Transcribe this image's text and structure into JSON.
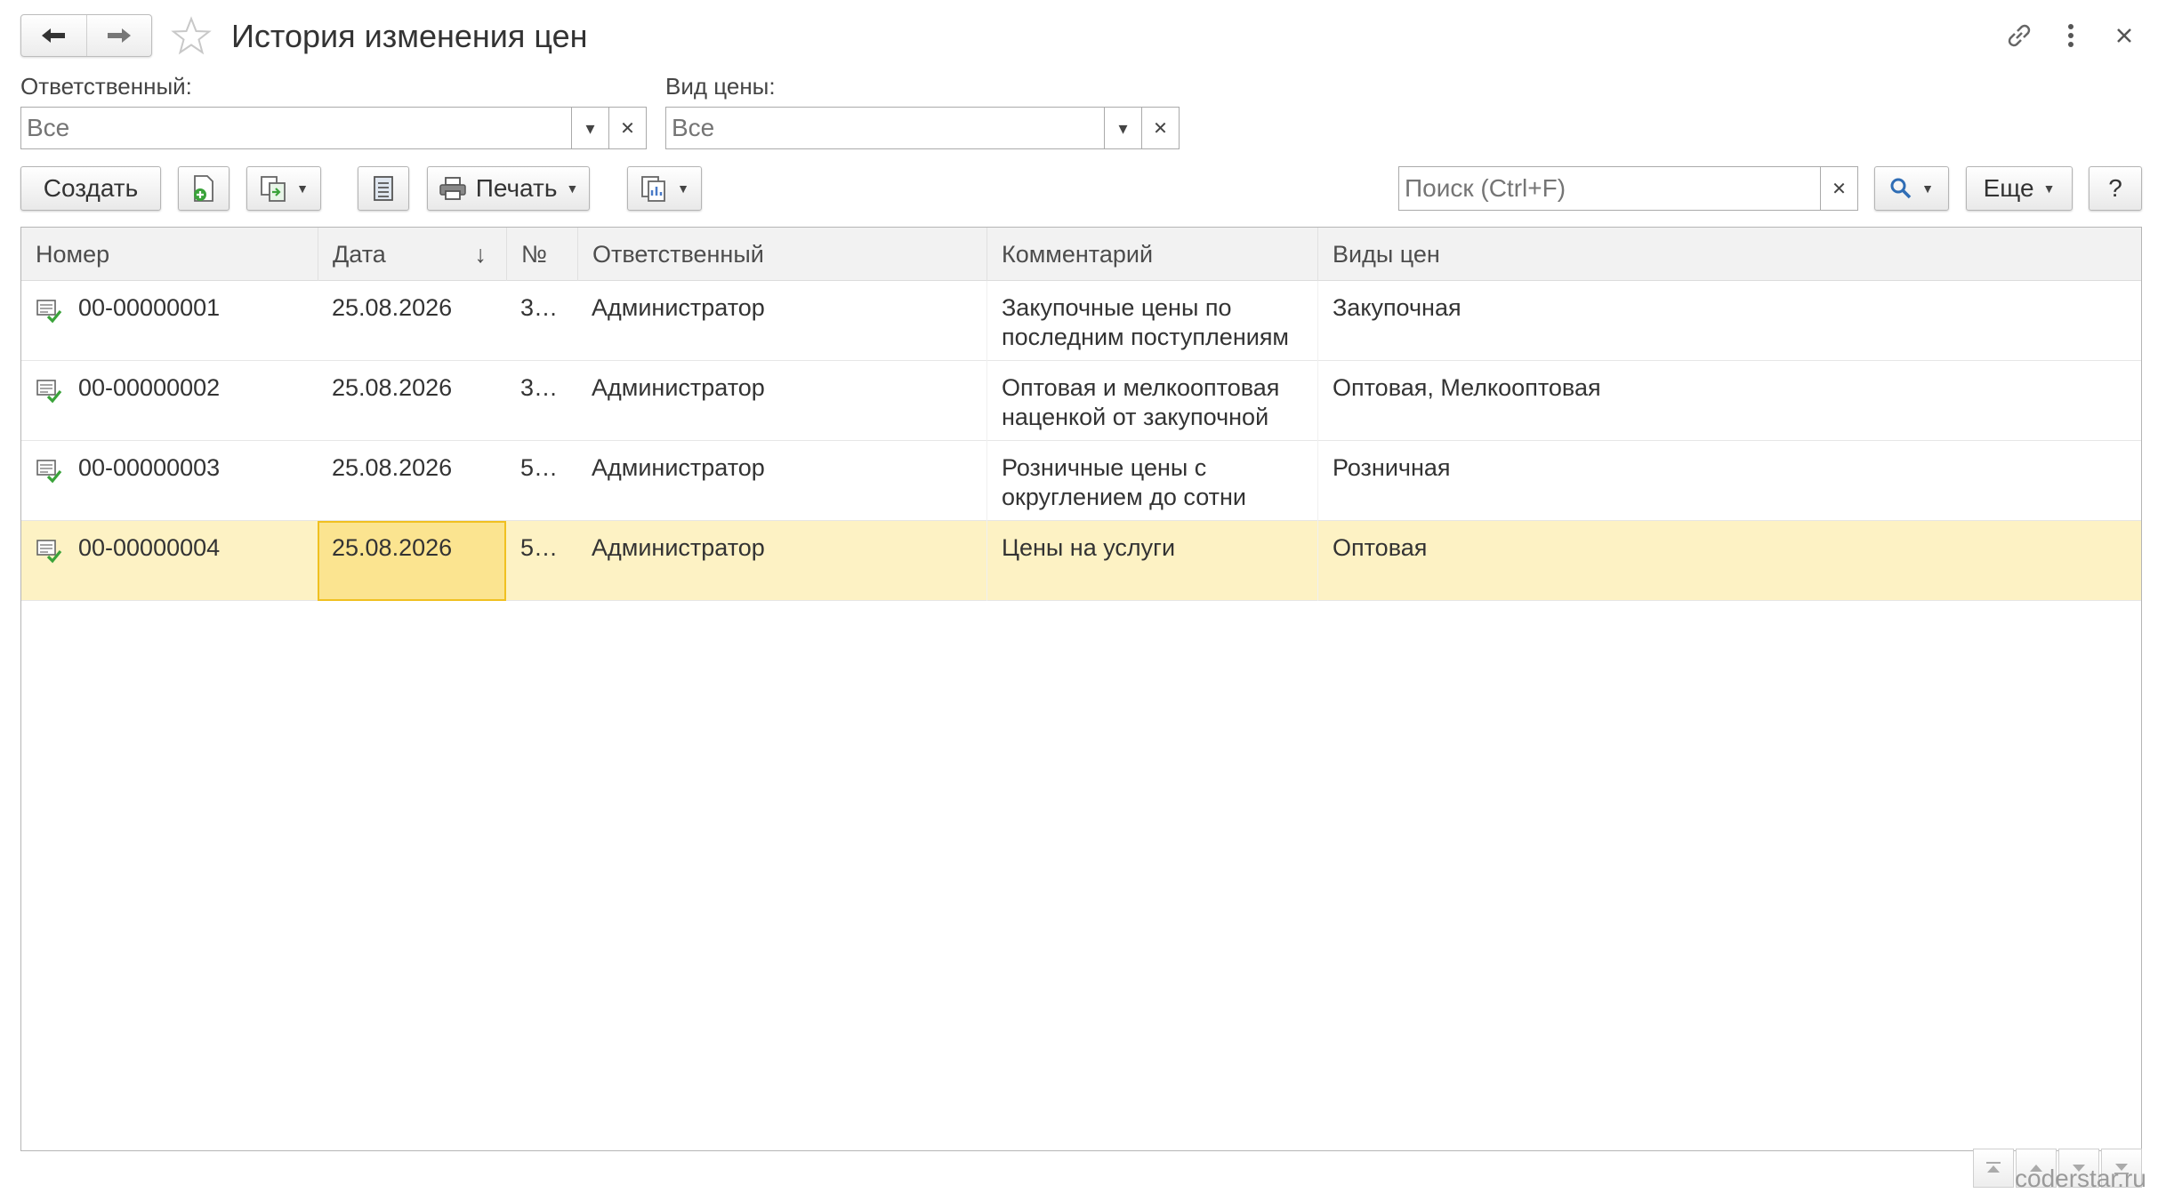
{
  "window": {
    "title": "История изменения цен"
  },
  "filters": {
    "responsible": {
      "label": "Ответственный:",
      "placeholder": "Все"
    },
    "price_type": {
      "label": "Вид цены:",
      "placeholder": "Все"
    }
  },
  "toolbar": {
    "create_label": "Создать",
    "print_label": "Печать",
    "search_placeholder": "Поиск (Ctrl+F)",
    "more_label": "Еще",
    "help_label": "?"
  },
  "table": {
    "columns": [
      "Номер",
      "Дата",
      "№",
      "Ответственный",
      "Комментарий",
      "Виды цен"
    ],
    "sort_indicator": "↓",
    "rows": [
      {
        "number": "00-00000001",
        "date": "25.08.2026",
        "no": "3…",
        "responsible": "Администратор",
        "comment_line1": "Закупочные цены по",
        "comment_line2": "последним поступлениям",
        "price_types": "Закупочная"
      },
      {
        "number": "00-00000002",
        "date": "25.08.2026",
        "no": "3…",
        "responsible": "Администратор",
        "comment_line1": "Оптовая и мелкооптовая",
        "comment_line2": "наценкой от закупочной",
        "price_types": "Оптовая, Мелкооптовая"
      },
      {
        "number": "00-00000003",
        "date": "25.08.2026",
        "no": "5…",
        "responsible": "Администратор",
        "comment_line1": "Розничные цены с",
        "comment_line2": "округлением до сотни",
        "price_types": "Розничная"
      },
      {
        "number": "00-00000004",
        "date": "25.08.2026",
        "no": "5…",
        "responsible": "Администратор",
        "comment_line1": "Цены на услуги",
        "comment_line2": "",
        "price_types": "Оптовая"
      }
    ]
  },
  "watermark": "coderstar.ru",
  "colors": {
    "selected_row": "#fdf2c4",
    "current_cell": "#fbe490",
    "current_cell_border": "#f0c020",
    "posted_check": "#3aa33a"
  }
}
